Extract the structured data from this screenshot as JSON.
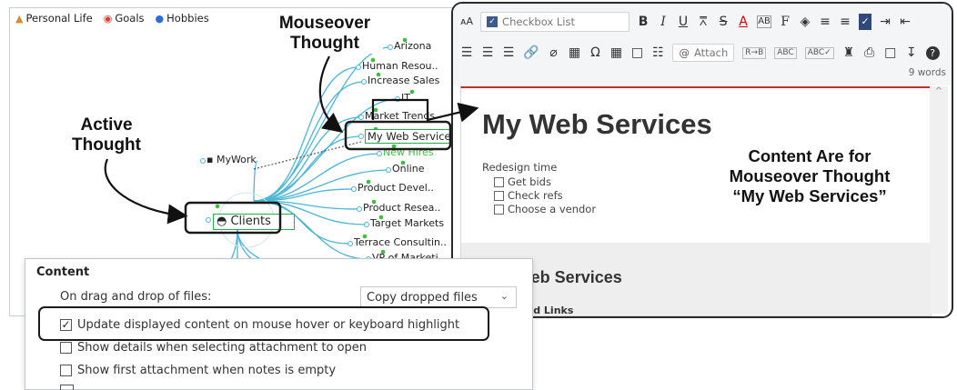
{
  "mindmap": {
    "tabs": [
      {
        "label": "Personal Life",
        "icon": "personal-life-icon"
      },
      {
        "label": "Goals",
        "icon": "goals-icon"
      },
      {
        "label": "Hobbies",
        "icon": "hobbies-icon"
      }
    ],
    "parent_thought": "MyWork",
    "active_thought": "Clients",
    "mouseover_thought": "My Web Services",
    "children": [
      "Arizona",
      "Human Resou..",
      "Increase Sales",
      "IT",
      "Market Trends",
      "My Web Services",
      "New Hires",
      "Online",
      "Product Devel..",
      "Product Resea..",
      "Target Markets",
      "Terrace Consultin..",
      "VP of Marketi.."
    ],
    "link_color": "#4ab6d8",
    "node_dot_color": "#3bbf3b",
    "highlight_color": "#22b14c"
  },
  "editor": {
    "toolbar": {
      "style_label": "Checkbox List",
      "attach_label": "Attach",
      "word_count": "9 words"
    },
    "document": {
      "title": "My Web Services",
      "subtitle": "Redesign time",
      "checklist": [
        "Get bids",
        "Check refs",
        "Choose a vendor"
      ],
      "lower_title": "Web Services",
      "lower_subtitle": "pped Links"
    }
  },
  "callouts": {
    "mouseover": [
      "Mouseover",
      "Thought"
    ],
    "active": [
      "Active",
      "Thought"
    ],
    "content": [
      "Content Are for",
      "Mouseover Thought",
      "“My Web Services”"
    ]
  },
  "options": {
    "heading": "Content",
    "drag_drop_label": "On drag and drop of files:",
    "drag_drop_value": "Copy dropped files",
    "checkboxes": [
      {
        "label": "Update displayed content on mouse hover or keyboard highlight",
        "checked": true
      },
      {
        "label": "Show details when selecting attachment to open",
        "checked": false
      },
      {
        "label": "Show first attachment when notes is empty",
        "checked": false
      }
    ]
  }
}
